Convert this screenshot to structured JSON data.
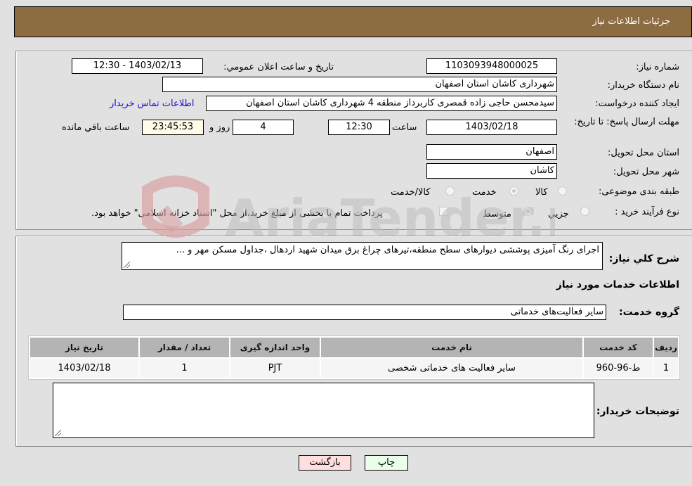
{
  "header": {
    "title": "جزئیات اطلاعات نیاز"
  },
  "details": {
    "need_number_label": "شماره نیاز:",
    "need_number": "1103093948000025",
    "announce_label": "تاریخ و ساعت اعلان عمومي:",
    "announce_value": "1403/02/13 - 12:30",
    "buyer_org_label": "نام دستگاه خریدار:",
    "buyer_org": "شهرداری کاشان استان اصفهان",
    "creator_label": "ایجاد کننده درخواست:",
    "creator": "سیدمحسن حاجی زاده قمصری کاربرداز منطقه 4 شهرداری کاشان استان اصفهان",
    "contact_link": "اطلاعات تماس خریدار",
    "deadline_label": "مهلت ارسال پاسخ: تا تاریخ:",
    "deadline_date": "1403/02/18",
    "time_label": "ساعت",
    "deadline_time": "12:30",
    "days": "4",
    "days_label": "روز و",
    "remaining_time": "23:45:53",
    "remaining_label": "ساعت باقي مانده",
    "province_label": "استان محل تحویل:",
    "province": "اصفهان",
    "city_label": "شهر محل تحویل:",
    "city": "کاشان",
    "category_label": "طبقه بندی موضوعی:",
    "category_options": [
      {
        "label": "کالا",
        "checked": false
      },
      {
        "label": "خدمت",
        "checked": true
      },
      {
        "label": "کالا/خدمت",
        "checked": false
      }
    ],
    "process_label": "نوع فرآیند خرید :",
    "process_options": [
      {
        "label": "جزيي",
        "checked": false
      },
      {
        "label": "متوسط",
        "checked": true
      }
    ],
    "treasury_note": "پرداخت تمام یا بخشی از مبلغ خرید،از محل \"اسناد خزانه اسلامی\" خواهد بود.",
    "treasury_checked": false
  },
  "needs": {
    "description_label": "شرح کلي نیاز:",
    "description": "اجرای رنگ آمیزی پوششی دیوارهای  سطح منطقه،تیرهای چراغ برق میدان شهید اردهال ،جداول مسکن مهر و ...",
    "services_title": "اطلاعات خدمات مورد نیاز",
    "service_group_label": "گروه خدمت:",
    "service_group": "سایر فعالیت‌های خدماتی",
    "table": {
      "headers": [
        "ردیف",
        "کد خدمت",
        "نام خدمت",
        "واحد اندازه گیری",
        "تعداد / مقدار",
        "تاریخ نیاز"
      ],
      "rows": [
        [
          "1",
          "ط-96-960",
          "سایر فعالیت های خدماتی شخصی",
          "PJT",
          "1",
          "1403/02/18"
        ]
      ]
    },
    "buyer_notes_label": "توضیحات خریدار:",
    "buyer_notes": ""
  },
  "buttons": {
    "print": "چاپ",
    "back": "بازگشت"
  },
  "watermark": {
    "text": "AriaTender.net"
  },
  "colors": {
    "header_bg": "#8c6d42",
    "print_bg": "#eaffea",
    "back_bg": "#ffdede",
    "remaining_bg": "#fffde9"
  }
}
